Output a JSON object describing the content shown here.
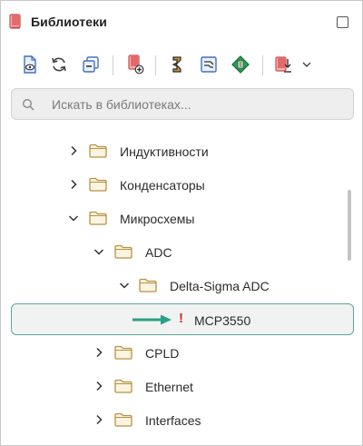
{
  "header": {
    "title": "Библиотеки"
  },
  "toolbar": {
    "buttons": [
      "view-document-icon",
      "refresh-icon",
      "collapse-all-icon",
      "add-library-icon",
      "symbol-icon",
      "schematic-icon",
      "component-icon",
      "export-library-icon",
      "dropdown-chevron-icon"
    ]
  },
  "search": {
    "placeholder": "Искать в библиотеках...",
    "value": ""
  },
  "tree": {
    "items": [
      {
        "label": "Индуктивности",
        "level": 0,
        "expanded": false
      },
      {
        "label": "Конденсаторы",
        "level": 0,
        "expanded": false
      },
      {
        "label": "Микросхемы",
        "level": 0,
        "expanded": true
      },
      {
        "label": "ADC",
        "level": 1,
        "expanded": true
      },
      {
        "label": "Delta-Sigma ADC",
        "level": 2,
        "expanded": true
      },
      {
        "label": "MCP3550",
        "level": 3,
        "selected": true,
        "status": "warning"
      },
      {
        "label": "CPLD",
        "level": 1,
        "expanded": false
      },
      {
        "label": "Ethernet",
        "level": 1,
        "expanded": false
      },
      {
        "label": "Interfaces",
        "level": 1,
        "expanded": false
      }
    ]
  },
  "colors": {
    "accent": "#5aa79c",
    "arrow": "#2aa08a",
    "warning": "#d42a2a",
    "folder": "#b8913f",
    "selection_bg": "#f1f2f2"
  }
}
